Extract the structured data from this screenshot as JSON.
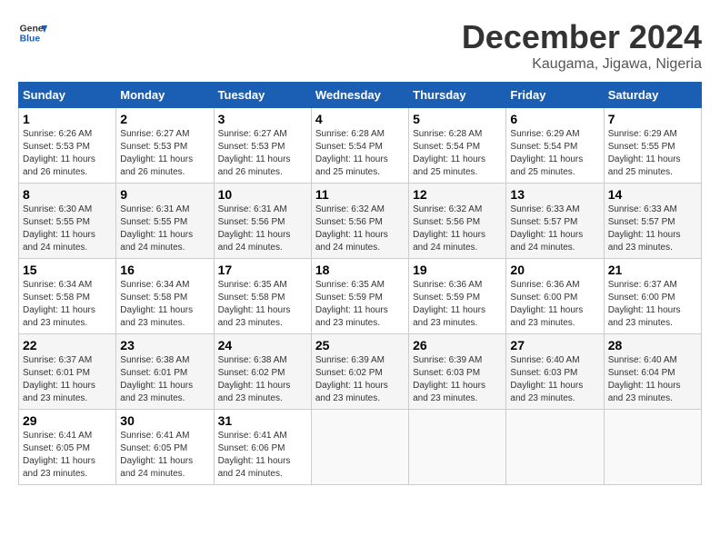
{
  "logo": {
    "line1": "General",
    "line2": "Blue"
  },
  "title": "December 2024",
  "subtitle": "Kaugama, Jigawa, Nigeria",
  "weekdays": [
    "Sunday",
    "Monday",
    "Tuesday",
    "Wednesday",
    "Thursday",
    "Friday",
    "Saturday"
  ],
  "weeks": [
    [
      {
        "day": "1",
        "sunrise": "6:26 AM",
        "sunset": "5:53 PM",
        "daylight": "11 hours and 26 minutes."
      },
      {
        "day": "2",
        "sunrise": "6:27 AM",
        "sunset": "5:53 PM",
        "daylight": "11 hours and 26 minutes."
      },
      {
        "day": "3",
        "sunrise": "6:27 AM",
        "sunset": "5:53 PM",
        "daylight": "11 hours and 26 minutes."
      },
      {
        "day": "4",
        "sunrise": "6:28 AM",
        "sunset": "5:54 PM",
        "daylight": "11 hours and 25 minutes."
      },
      {
        "day": "5",
        "sunrise": "6:28 AM",
        "sunset": "5:54 PM",
        "daylight": "11 hours and 25 minutes."
      },
      {
        "day": "6",
        "sunrise": "6:29 AM",
        "sunset": "5:54 PM",
        "daylight": "11 hours and 25 minutes."
      },
      {
        "day": "7",
        "sunrise": "6:29 AM",
        "sunset": "5:55 PM",
        "daylight": "11 hours and 25 minutes."
      }
    ],
    [
      {
        "day": "8",
        "sunrise": "6:30 AM",
        "sunset": "5:55 PM",
        "daylight": "11 hours and 24 minutes."
      },
      {
        "day": "9",
        "sunrise": "6:31 AM",
        "sunset": "5:55 PM",
        "daylight": "11 hours and 24 minutes."
      },
      {
        "day": "10",
        "sunrise": "6:31 AM",
        "sunset": "5:56 PM",
        "daylight": "11 hours and 24 minutes."
      },
      {
        "day": "11",
        "sunrise": "6:32 AM",
        "sunset": "5:56 PM",
        "daylight": "11 hours and 24 minutes."
      },
      {
        "day": "12",
        "sunrise": "6:32 AM",
        "sunset": "5:56 PM",
        "daylight": "11 hours and 24 minutes."
      },
      {
        "day": "13",
        "sunrise": "6:33 AM",
        "sunset": "5:57 PM",
        "daylight": "11 hours and 24 minutes."
      },
      {
        "day": "14",
        "sunrise": "6:33 AM",
        "sunset": "5:57 PM",
        "daylight": "11 hours and 23 minutes."
      }
    ],
    [
      {
        "day": "15",
        "sunrise": "6:34 AM",
        "sunset": "5:58 PM",
        "daylight": "11 hours and 23 minutes."
      },
      {
        "day": "16",
        "sunrise": "6:34 AM",
        "sunset": "5:58 PM",
        "daylight": "11 hours and 23 minutes."
      },
      {
        "day": "17",
        "sunrise": "6:35 AM",
        "sunset": "5:58 PM",
        "daylight": "11 hours and 23 minutes."
      },
      {
        "day": "18",
        "sunrise": "6:35 AM",
        "sunset": "5:59 PM",
        "daylight": "11 hours and 23 minutes."
      },
      {
        "day": "19",
        "sunrise": "6:36 AM",
        "sunset": "5:59 PM",
        "daylight": "11 hours and 23 minutes."
      },
      {
        "day": "20",
        "sunrise": "6:36 AM",
        "sunset": "6:00 PM",
        "daylight": "11 hours and 23 minutes."
      },
      {
        "day": "21",
        "sunrise": "6:37 AM",
        "sunset": "6:00 PM",
        "daylight": "11 hours and 23 minutes."
      }
    ],
    [
      {
        "day": "22",
        "sunrise": "6:37 AM",
        "sunset": "6:01 PM",
        "daylight": "11 hours and 23 minutes."
      },
      {
        "day": "23",
        "sunrise": "6:38 AM",
        "sunset": "6:01 PM",
        "daylight": "11 hours and 23 minutes."
      },
      {
        "day": "24",
        "sunrise": "6:38 AM",
        "sunset": "6:02 PM",
        "daylight": "11 hours and 23 minutes."
      },
      {
        "day": "25",
        "sunrise": "6:39 AM",
        "sunset": "6:02 PM",
        "daylight": "11 hours and 23 minutes."
      },
      {
        "day": "26",
        "sunrise": "6:39 AM",
        "sunset": "6:03 PM",
        "daylight": "11 hours and 23 minutes."
      },
      {
        "day": "27",
        "sunrise": "6:40 AM",
        "sunset": "6:03 PM",
        "daylight": "11 hours and 23 minutes."
      },
      {
        "day": "28",
        "sunrise": "6:40 AM",
        "sunset": "6:04 PM",
        "daylight": "11 hours and 23 minutes."
      }
    ],
    [
      {
        "day": "29",
        "sunrise": "6:41 AM",
        "sunset": "6:05 PM",
        "daylight": "11 hours and 23 minutes."
      },
      {
        "day": "30",
        "sunrise": "6:41 AM",
        "sunset": "6:05 PM",
        "daylight": "11 hours and 24 minutes."
      },
      {
        "day": "31",
        "sunrise": "6:41 AM",
        "sunset": "6:06 PM",
        "daylight": "11 hours and 24 minutes."
      },
      null,
      null,
      null,
      null
    ]
  ]
}
